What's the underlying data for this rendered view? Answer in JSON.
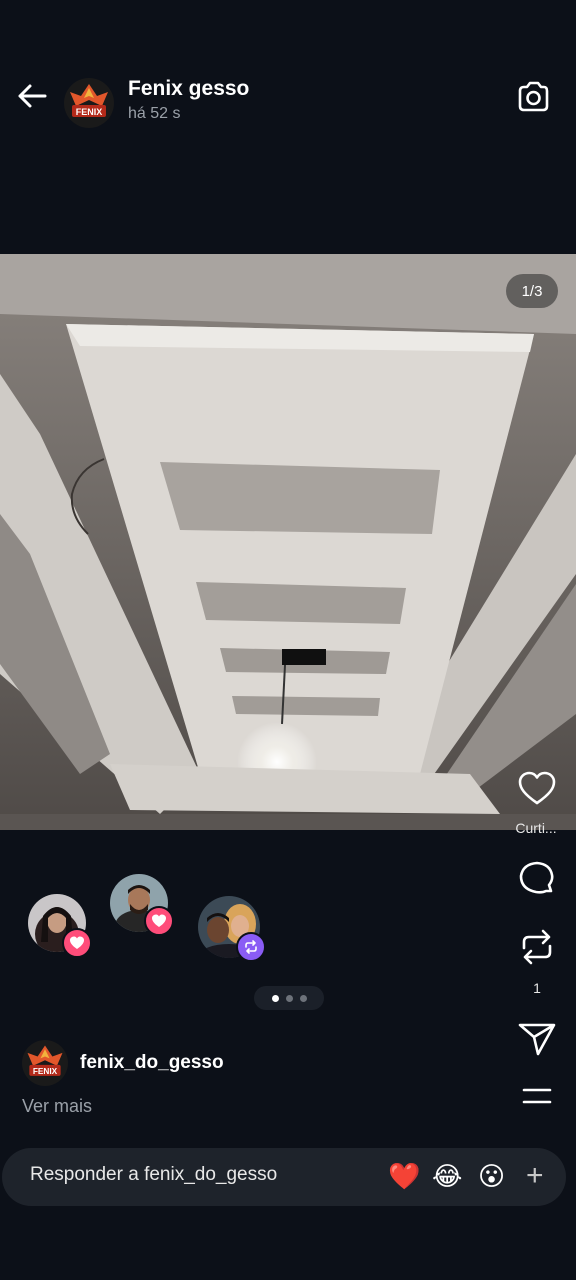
{
  "header": {
    "title": "Fenix gesso",
    "time": "há 52 s",
    "avatar_text": "FENIX"
  },
  "media": {
    "counter": "1/3"
  },
  "rail": {
    "like_label": "Curti...",
    "repost_count": "1"
  },
  "viewers": [
    {
      "reaction": "heart"
    },
    {
      "reaction": "heart"
    },
    {
      "reaction": "repost"
    }
  ],
  "pagination": {
    "total": 3,
    "active": 0
  },
  "owner": {
    "username": "fenix_do_gesso",
    "see_more": "Ver mais",
    "avatar_text": "FENIX"
  },
  "reply": {
    "placeholder": "Responder a fenix_do_gesso",
    "emojis": [
      "❤️",
      "😂",
      "😮"
    ],
    "add_symbol": "+"
  },
  "colors": {
    "background": "#0c1018",
    "heart_badge": "#ff4d7a",
    "repost_badge": "#8a5cf5"
  }
}
